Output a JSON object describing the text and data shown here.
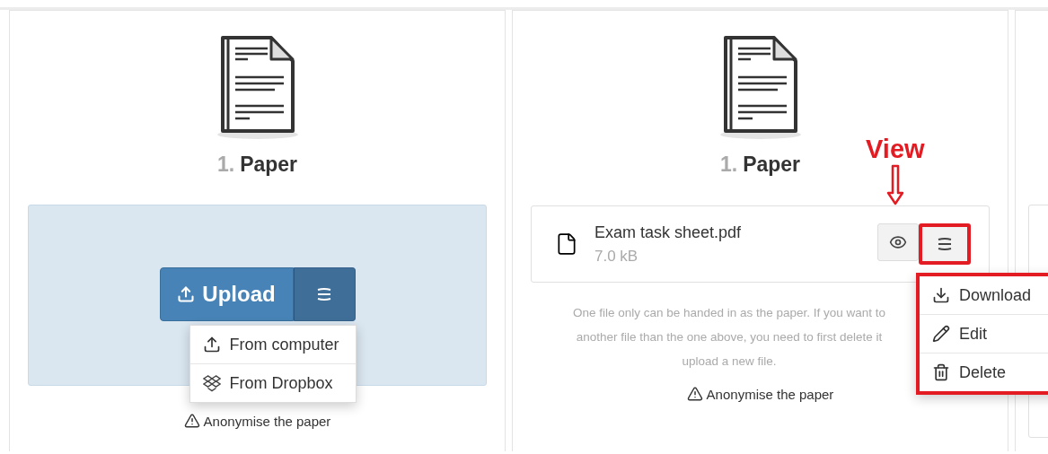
{
  "panels": [
    {
      "kind": "upload",
      "number": "1.",
      "title": "Paper",
      "upload": {
        "label": "Upload",
        "menu_open": true,
        "menu": [
          {
            "kind": "upload",
            "label": "From computer"
          },
          {
            "kind": "dropbox",
            "label": "From Dropbox"
          }
        ]
      },
      "anonymise": "Anonymise the paper"
    },
    {
      "kind": "file",
      "number": "1.",
      "title": "Paper",
      "file": {
        "name": "Exam task sheet.pdf",
        "size": "7.0 kB",
        "menu_highlighted": true,
        "menu_open": true,
        "menu": [
          {
            "kind": "download",
            "label": "Download"
          },
          {
            "kind": "edit",
            "label": "Edit"
          },
          {
            "kind": "delete",
            "label": "Delete"
          }
        ]
      },
      "note_lines": [
        "One file only can be handed in as the paper. If you want to",
        "another file than the one above, you need to first delete it",
        "upload a new file."
      ],
      "anonymise": "Anonymise the paper",
      "callout": "View"
    },
    {
      "kind": "blank"
    }
  ]
}
